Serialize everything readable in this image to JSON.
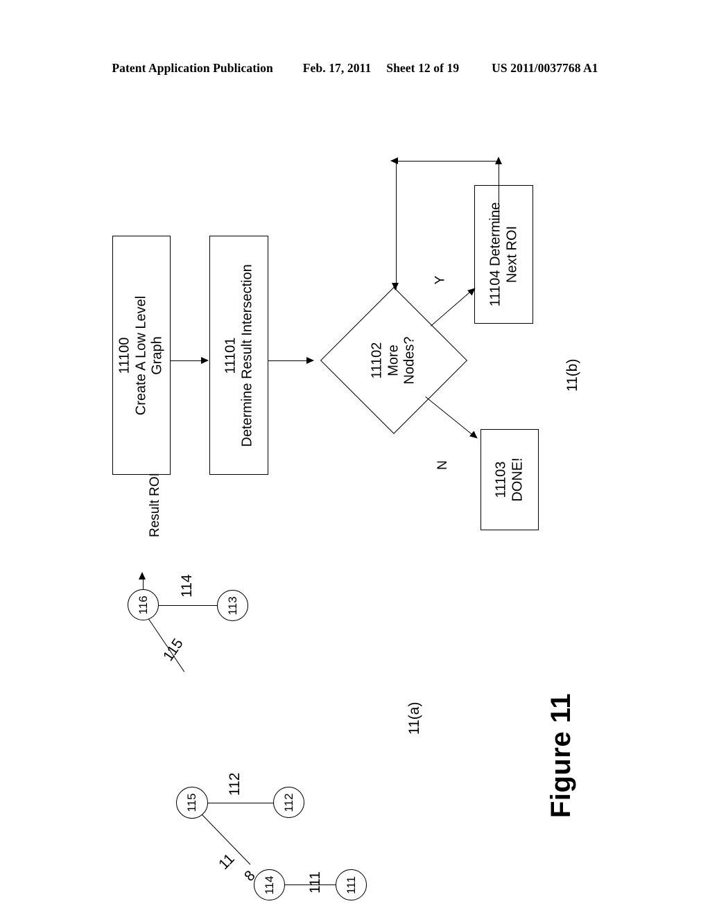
{
  "header": {
    "publication": "Patent Application Publication",
    "date": "Feb. 17, 2011",
    "sheet": "Sheet 12 of 19",
    "patent_number": "US 2011/0037768 A1"
  },
  "figure": {
    "title": "Figure 11",
    "sub_caption_a": "11(a)",
    "sub_caption_b": "11(b)"
  },
  "flowchart": {
    "result_roi_label": "Result ROI",
    "boxes": [
      {
        "id": "11100",
        "number": "11100",
        "line1": "Create A Low Level",
        "line2": "Graph"
      },
      {
        "id": "11101",
        "number": "11101",
        "line1": "Determine Result Intersection",
        "line2": ""
      },
      {
        "id": "11104",
        "number": "11104 Determine",
        "line1": "Next ROI",
        "line2": ""
      },
      {
        "id": "11103",
        "number": "11103",
        "line1": "DONE!",
        "line2": ""
      }
    ],
    "decision": {
      "number": "11102",
      "line1": "More",
      "line2": "Nodes?"
    },
    "branches": {
      "yes": "Y",
      "no": "N"
    }
  },
  "graph": {
    "nodes": [
      {
        "id": "n116",
        "label": "116"
      },
      {
        "id": "n113",
        "label": "113"
      },
      {
        "id": "n115",
        "label": "115"
      },
      {
        "id": "n112",
        "label": "112"
      },
      {
        "id": "n114",
        "label": "114"
      },
      {
        "id": "n111",
        "label": "111"
      }
    ],
    "edges": [
      {
        "id": "e114",
        "label": "114",
        "from": "116",
        "to": "113"
      },
      {
        "id": "e115",
        "label": "115",
        "from": "116",
        "to": "115"
      },
      {
        "id": "e112",
        "label": "112",
        "from": "115",
        "to": "112"
      },
      {
        "id": "e118",
        "label": "118",
        "label_part1": "11",
        "label_part2": "8",
        "from": "115",
        "to": "114"
      },
      {
        "id": "e111",
        "label": "111",
        "from": "114",
        "to": "111"
      }
    ],
    "output_label": "Result ROI"
  },
  "colors": {
    "ink": "#000000",
    "paper": "#ffffff"
  }
}
